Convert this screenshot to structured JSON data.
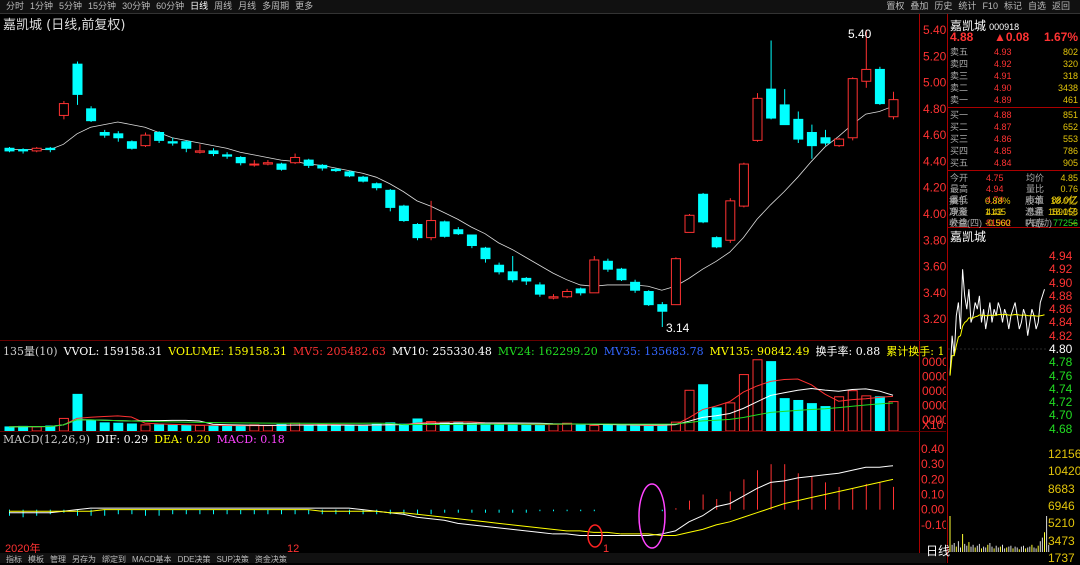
{
  "toolbar": {
    "timeframes": [
      "分时",
      "1分钟",
      "5分钟",
      "15分钟",
      "30分钟",
      "60分钟",
      "日线",
      "周线",
      "月线",
      "多周期",
      "更多"
    ],
    "active": "日线",
    "right_buttons": [
      "置权",
      "叠加",
      "历史",
      "统计",
      "F10",
      "标记",
      "自选",
      "返回"
    ]
  },
  "chart_title": "嘉凯城 (日线,前复权)",
  "price_axis": [
    "5.40",
    "5.20",
    "5.00",
    "4.80",
    "4.60",
    "4.40",
    "4.20",
    "4.00",
    "3.80",
    "3.60",
    "3.40",
    "3.20"
  ],
  "high_label": "5.40",
  "low_label": "3.14",
  "volume_header": {
    "name": "135量(10)",
    "vvol": "VVOL: 159158.31",
    "volume": "VOLUME: 159158.31",
    "mv5": "MV5: 205482.63",
    "mv10": "MV10: 255330.48",
    "mv24": "MV24: 162299.20",
    "mv35": "MV35: 135683.78",
    "mv135": "MV135: 90842.49",
    "turnover": "换手率: 0.88",
    "cum": "累计换手: 1"
  },
  "volume_axis": [
    "0000",
    "0000",
    "0000",
    "0000",
    "0000"
  ],
  "volume_unit": "X10",
  "macd_header": {
    "name": "MACD(12,26,9)",
    "dif": "DIF: 0.29",
    "dea": "DEA: 0.20",
    "macd": "MACD: 0.18"
  },
  "macd_axis": [
    "0.40",
    "0.30",
    "0.20",
    "0.10",
    "0.00",
    "-0.10"
  ],
  "date_labels": {
    "y2020": "2020年",
    "m12": "12",
    "m1": "1"
  },
  "bottom_tabs": [
    "指标",
    "模板",
    "管理",
    "另存为",
    "绑定到",
    "MACD基本",
    "DDE决策",
    "SUP决策",
    "资金决策"
  ],
  "colors": {
    "up": "#ff3232",
    "down": "#00ffff",
    "white_line": "#ffffff",
    "yellow_line": "#ffff00",
    "magenta": "#ff44ff",
    "green": "#22dd22",
    "blue": "#3366ff",
    "panel_text": "#e3c50b"
  },
  "panel": {
    "name": "嘉凯城",
    "code": "000918",
    "price": "4.88",
    "change": "▲0.08",
    "pct": "1.67%",
    "asks": [
      {
        "l": "卖五",
        "p": "4.93",
        "v": "802"
      },
      {
        "l": "卖四",
        "p": "4.92",
        "v": "320"
      },
      {
        "l": "卖三",
        "p": "4.91",
        "v": "318"
      },
      {
        "l": "卖二",
        "p": "4.90",
        "v": "3438"
      },
      {
        "l": "卖一",
        "p": "4.89",
        "v": "461"
      }
    ],
    "bids": [
      {
        "l": "买一",
        "p": "4.88",
        "v": "851"
      },
      {
        "l": "买二",
        "p": "4.87",
        "v": "652"
      },
      {
        "l": "买三",
        "p": "4.86",
        "v": "553"
      },
      {
        "l": "买四",
        "p": "4.85",
        "v": "786"
      },
      {
        "l": "买五",
        "p": "4.84",
        "v": "905"
      }
    ],
    "stats": [
      [
        "今开",
        "4.75",
        "均价",
        "4.85"
      ],
      [
        "最高",
        "4.94",
        "量比",
        "0.76"
      ],
      [
        "最低",
        "4.74",
        "市值",
        "88.0亿"
      ],
      [
        "现量",
        "4135",
        "总量",
        "159158"
      ],
      [
        "外盘",
        "81902",
        "内盘",
        "77256"
      ]
    ],
    "stats2": [
      [
        "换手",
        "0.88%",
        "股本",
        "18.0亿"
      ],
      [
        "净资",
        "1.42",
        "流通",
        "18.0亿"
      ],
      [
        "收益(四)",
        "-0.560",
        "PE(动)",
        "--"
      ]
    ],
    "mini_title": "嘉凯城",
    "mini_axis": [
      "4.94",
      "4.92",
      "4.90",
      "4.88",
      "4.86",
      "4.84",
      "4.82",
      "4.80",
      "4.78",
      "4.76",
      "4.74",
      "4.72",
      "4.70",
      "4.68"
    ],
    "mini_vol_axis": [
      "12156",
      "10420",
      "8683",
      "6946",
      "5210",
      "3473",
      "1737"
    ],
    "mini_tab": "日线"
  },
  "chart_data": {
    "type": "candlestick",
    "title": "嘉凯城 (日线,前复权)",
    "candles": [
      [
        4.5,
        4.48,
        4.51,
        4.47
      ],
      [
        4.49,
        4.48,
        4.5,
        4.46
      ],
      [
        4.48,
        4.5,
        4.51,
        4.47
      ],
      [
        4.5,
        4.49,
        4.51,
        4.47
      ],
      [
        4.75,
        4.84,
        4.86,
        4.72
      ],
      [
        5.14,
        4.91,
        5.16,
        4.83
      ],
      [
        4.8,
        4.71,
        4.82,
        4.7
      ],
      [
        4.62,
        4.6,
        4.64,
        4.58
      ],
      [
        4.61,
        4.58,
        4.63,
        4.55
      ],
      [
        4.55,
        4.5,
        4.56,
        4.49
      ],
      [
        4.52,
        4.6,
        4.62,
        4.51
      ],
      [
        4.62,
        4.56,
        4.63,
        4.54
      ],
      [
        4.55,
        4.54,
        4.58,
        4.52
      ],
      [
        4.55,
        4.5,
        4.56,
        4.47
      ],
      [
        4.47,
        4.48,
        4.53,
        4.46
      ],
      [
        4.48,
        4.46,
        4.5,
        4.44
      ],
      [
        4.45,
        4.44,
        4.47,
        4.42
      ],
      [
        4.43,
        4.39,
        4.44,
        4.37
      ],
      [
        4.38,
        4.38,
        4.41,
        4.36
      ],
      [
        4.38,
        4.39,
        4.41,
        4.37
      ],
      [
        4.38,
        4.34,
        4.39,
        4.33
      ],
      [
        4.39,
        4.43,
        4.46,
        4.38
      ],
      [
        4.41,
        4.37,
        4.42,
        4.35
      ],
      [
        4.37,
        4.35,
        4.38,
        4.33
      ],
      [
        4.34,
        4.33,
        4.35,
        4.32
      ],
      [
        4.32,
        4.29,
        4.33,
        4.28
      ],
      [
        4.28,
        4.25,
        4.29,
        4.24
      ],
      [
        4.23,
        4.2,
        4.24,
        4.18
      ],
      [
        4.18,
        4.05,
        4.19,
        4.02
      ],
      [
        4.06,
        3.95,
        4.07,
        3.94
      ],
      [
        3.92,
        3.82,
        3.93,
        3.8
      ],
      [
        3.82,
        3.95,
        4.1,
        3.8
      ],
      [
        3.94,
        3.83,
        3.95,
        3.82
      ],
      [
        3.88,
        3.85,
        3.9,
        3.84
      ],
      [
        3.84,
        3.76,
        3.84,
        3.74
      ],
      [
        3.74,
        3.66,
        3.75,
        3.63
      ],
      [
        3.61,
        3.56,
        3.63,
        3.54
      ],
      [
        3.56,
        3.5,
        3.68,
        3.48
      ],
      [
        3.51,
        3.49,
        3.52,
        3.46
      ],
      [
        3.46,
        3.39,
        3.48,
        3.37
      ],
      [
        3.36,
        3.37,
        3.39,
        3.35
      ],
      [
        3.37,
        3.41,
        3.43,
        3.36
      ],
      [
        3.43,
        3.4,
        3.44,
        3.38
      ],
      [
        3.4,
        3.65,
        3.68,
        3.4
      ],
      [
        3.64,
        3.58,
        3.66,
        3.56
      ],
      [
        3.58,
        3.5,
        3.59,
        3.49
      ],
      [
        3.48,
        3.42,
        3.5,
        3.4
      ],
      [
        3.41,
        3.31,
        3.42,
        3.3
      ],
      [
        3.31,
        3.26,
        3.33,
        3.14
      ],
      [
        3.31,
        3.66,
        3.67,
        3.31
      ],
      [
        3.86,
        3.99,
        4.0,
        3.86
      ],
      [
        4.15,
        3.94,
        4.16,
        3.93
      ],
      [
        3.82,
        3.75,
        3.83,
        3.74
      ],
      [
        3.8,
        4.1,
        4.12,
        3.78
      ],
      [
        4.06,
        4.38,
        4.39,
        4.05
      ],
      [
        4.56,
        4.88,
        4.92,
        4.55
      ],
      [
        4.95,
        4.73,
        5.32,
        4.72
      ],
      [
        4.83,
        4.68,
        4.95,
        4.68
      ],
      [
        4.72,
        4.57,
        4.78,
        4.54
      ],
      [
        4.62,
        4.52,
        4.68,
        4.42
      ],
      [
        4.58,
        4.54,
        4.64,
        4.52
      ],
      [
        4.52,
        4.57,
        4.58,
        4.51
      ],
      [
        4.58,
        5.03,
        5.04,
        4.56
      ],
      [
        5.01,
        5.1,
        5.4,
        4.96
      ],
      [
        5.1,
        4.84,
        5.12,
        4.83
      ],
      [
        4.74,
        4.87,
        4.93,
        4.72
      ]
    ],
    "volumes": [
      2.2,
      2.5,
      2.3,
      2.7,
      6.8,
      19.8,
      5.6,
      4.4,
      4.2,
      3.8,
      3.3,
      3.4,
      3.1,
      3.2,
      3.0,
      2.8,
      2.8,
      2.7,
      3.3,
      3.0,
      3.5,
      4.2,
      3.0,
      3.4,
      3.2,
      2.7,
      3.0,
      3.6,
      4.4,
      3.7,
      6.5,
      5.1,
      4.4,
      4.9,
      3.9,
      3.6,
      3.3,
      3.4,
      3.5,
      3.5,
      3.7,
      4.2,
      3.7,
      3.0,
      3.0,
      3.1,
      3.0,
      2.9,
      3.3,
      4.8,
      22.0,
      25.0,
      12.5,
      15.2,
      30.5,
      38.5,
      37.5,
      17.5,
      16.5,
      14.8,
      13.2,
      18.5,
      21.8,
      19.0,
      18.5,
      15.9
    ],
    "macd_hist": [
      -0.04,
      -0.05,
      -0.04,
      -0.03,
      -0.02,
      -0.04,
      -0.04,
      -0.04,
      -0.03,
      -0.03,
      -0.04,
      -0.04,
      -0.03,
      -0.03,
      -0.03,
      -0.03,
      -0.03,
      -0.03,
      -0.03,
      -0.03,
      -0.03,
      -0.03,
      -0.03,
      -0.03,
      -0.03,
      -0.03,
      -0.03,
      -0.03,
      -0.03,
      -0.03,
      -0.03,
      -0.03,
      -0.02,
      -0.02,
      -0.02,
      -0.02,
      -0.02,
      -0.02,
      -0.02,
      -0.01,
      -0.01,
      -0.01,
      -0.01,
      -0.01,
      0.0,
      0.0,
      0.0,
      0.0,
      -0.01,
      0.01,
      0.06,
      0.1,
      0.07,
      0.12,
      0.2,
      0.26,
      0.3,
      0.3,
      0.24,
      0.22,
      0.18,
      0.15,
      0.14,
      0.17,
      0.18,
      0.15
    ],
    "dif": [
      -0.02,
      -0.02,
      -0.02,
      -0.02,
      -0.01,
      0.0,
      0.01,
      0.01,
      0.01,
      0.01,
      0.01,
      0.01,
      0.01,
      0.01,
      0.01,
      0.01,
      0.01,
      0.01,
      0.01,
      0.01,
      0.01,
      0.01,
      0.01,
      0.01,
      0.01,
      0.01,
      0.0,
      -0.01,
      -0.02,
      -0.03,
      -0.05,
      -0.06,
      -0.07,
      -0.09,
      -0.1,
      -0.11,
      -0.12,
      -0.13,
      -0.14,
      -0.15,
      -0.16,
      -0.16,
      -0.17,
      -0.17,
      -0.17,
      -0.17,
      -0.17,
      -0.17,
      -0.16,
      -0.14,
      -0.08,
      -0.04,
      0.02,
      0.04,
      0.09,
      0.14,
      0.18,
      0.19,
      0.21,
      0.22,
      0.23,
      0.24,
      0.26,
      0.28,
      0.28,
      0.29
    ],
    "dea": [
      -0.01,
      -0.01,
      -0.01,
      -0.01,
      -0.01,
      -0.01,
      -0.01,
      0.0,
      0.0,
      0.0,
      0.0,
      0.0,
      0.0,
      0.0,
      0.0,
      0.0,
      0.0,
      0.0,
      0.0,
      0.0,
      0.0,
      0.0,
      0.0,
      -0.01,
      -0.01,
      -0.01,
      -0.01,
      -0.01,
      -0.02,
      -0.02,
      -0.03,
      -0.04,
      -0.05,
      -0.06,
      -0.07,
      -0.08,
      -0.09,
      -0.1,
      -0.11,
      -0.12,
      -0.13,
      -0.14,
      -0.14,
      -0.15,
      -0.15,
      -0.16,
      -0.16,
      -0.16,
      -0.17,
      -0.17,
      -0.15,
      -0.13,
      -0.1,
      -0.08,
      -0.05,
      -0.02,
      0.01,
      0.04,
      0.06,
      0.08,
      0.1,
      0.12,
      0.14,
      0.16,
      0.18,
      0.2
    ],
    "ma_price": [
      4.49,
      4.49,
      4.49,
      4.49,
      4.53,
      4.61,
      4.66,
      4.68,
      4.7,
      4.68,
      4.66,
      4.62,
      4.58,
      4.56,
      4.54,
      4.52,
      4.5,
      4.47,
      4.45,
      4.43,
      4.41,
      4.4,
      4.38,
      4.37,
      4.35,
      4.33,
      4.31,
      4.28,
      4.23,
      4.17,
      4.1,
      4.06,
      4.01,
      3.96,
      3.9,
      3.85,
      3.78,
      3.73,
      3.67,
      3.61,
      3.55,
      3.5,
      3.46,
      3.45,
      3.46,
      3.46,
      3.46,
      3.45,
      3.42,
      3.45,
      3.51,
      3.58,
      3.64,
      3.71,
      3.82,
      3.96,
      4.07,
      4.17,
      4.28,
      4.4,
      4.51,
      4.59,
      4.68,
      4.76,
      4.78,
      4.82
    ]
  }
}
